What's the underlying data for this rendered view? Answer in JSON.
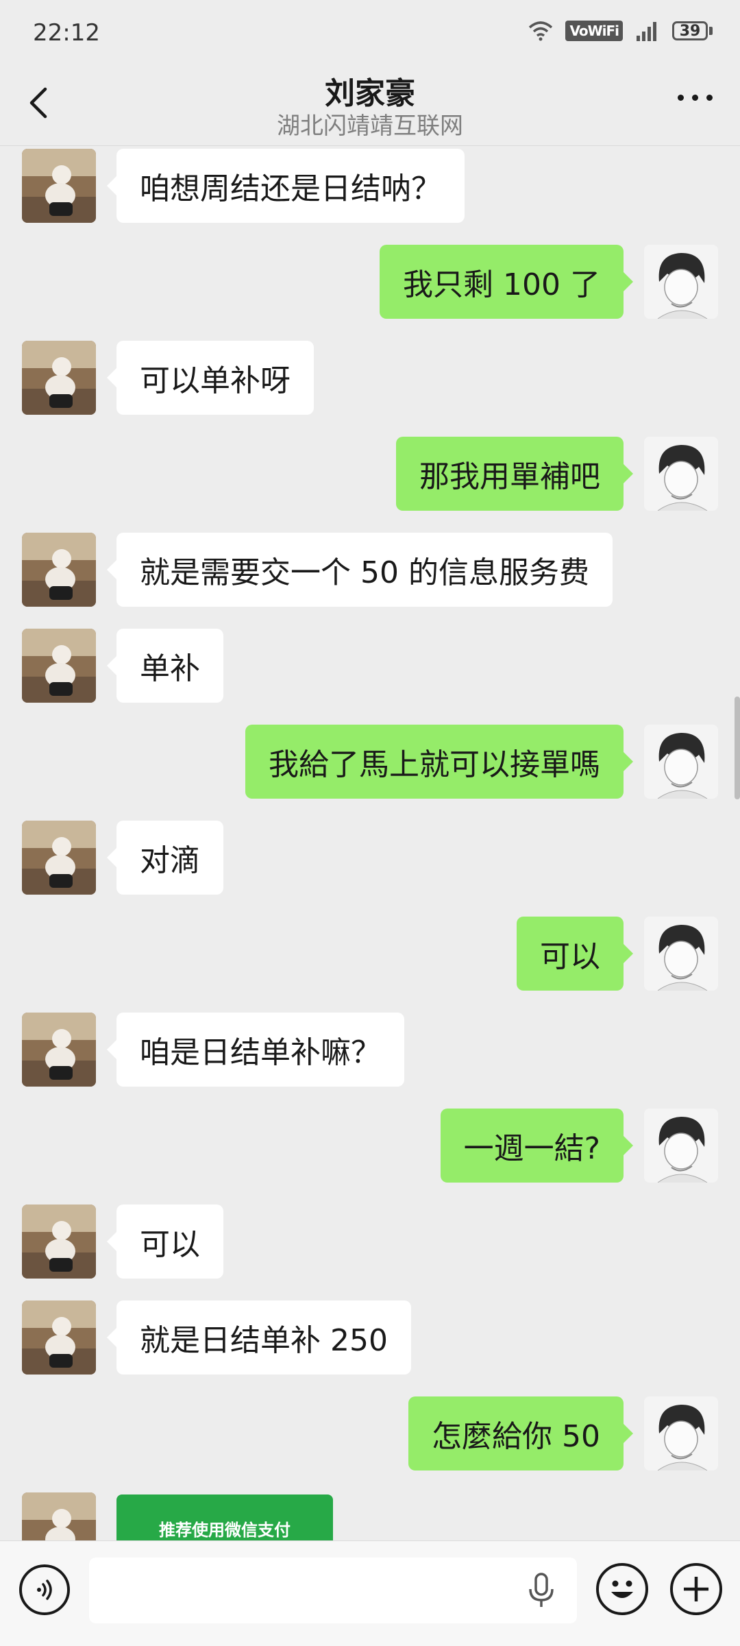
{
  "status_bar": {
    "time": "22:12",
    "network_label": "VoWiFi",
    "battery": "39"
  },
  "header": {
    "title": "刘家豪",
    "subtitle": "湖北闪靖靖互联网"
  },
  "messages": [
    {
      "side": "in",
      "text": "咱想周结还是日结呐？"
    },
    {
      "side": "out",
      "text": "我只剩 100 了"
    },
    {
      "side": "in",
      "text": "可以单补呀"
    },
    {
      "side": "out",
      "text": "那我用單補吧"
    },
    {
      "side": "in",
      "text": "就是需要交一个 50 的信息服务费"
    },
    {
      "side": "in",
      "text": "单补"
    },
    {
      "side": "out",
      "text": "我給了馬上就可以接單嗎"
    },
    {
      "side": "in",
      "text": "对滴"
    },
    {
      "side": "out",
      "text": "可以"
    },
    {
      "side": "in",
      "text": "咱是日结单补嘛？"
    },
    {
      "side": "out",
      "text": "一週一結?"
    },
    {
      "side": "in",
      "text": "可以"
    },
    {
      "side": "in",
      "text": "就是日结单补 250"
    },
    {
      "side": "out",
      "text": "怎麼給你 50"
    }
  ],
  "pay_card": {
    "label": "推荐使用微信支付"
  },
  "input_bar": {
    "placeholder": ""
  },
  "colors": {
    "background": "#ededed",
    "outgoing_bubble": "#95ec69",
    "incoming_bubble": "#ffffff",
    "pay_card": "#27a947"
  }
}
